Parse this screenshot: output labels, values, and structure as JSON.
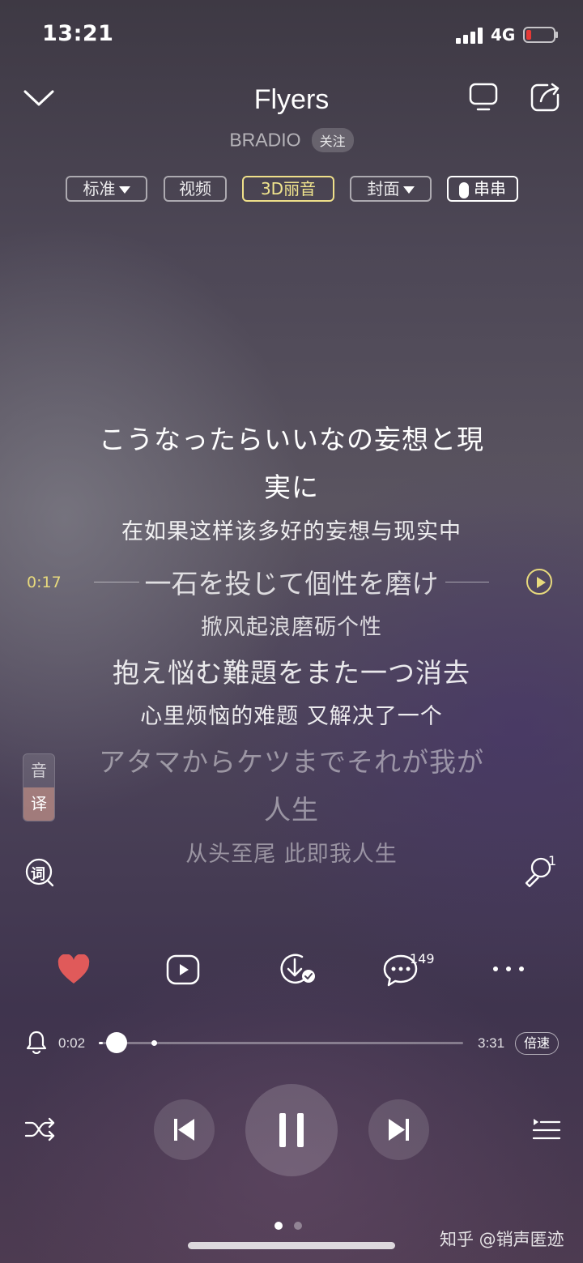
{
  "status_bar": {
    "time": "13:21",
    "network": "4G"
  },
  "header": {
    "title": "Flyers",
    "artist": "BRADIO",
    "follow_label": "关注"
  },
  "chips": {
    "standard": "标准",
    "video": "视频",
    "audio3d": "3D丽音",
    "cover": "封面",
    "chuan": "串串"
  },
  "lyrics": {
    "line1_jp_a": "こうなったらいいなの妄想と現",
    "line1_jp_b": "実に",
    "line1_cn": "在如果这样该多好的妄想与现实中",
    "current_time": "0:17",
    "current_jp": "一石を投じて個性を磨け",
    "current_cn": "掀风起浪磨砺个性",
    "line3_jp": "抱え悩む難題をまた一つ消去",
    "line3_cn": "心里烦恼的难题 又解决了一个",
    "line4_jp_a": "アタマからケツまでそれが我が",
    "line4_jp_b": "人生",
    "line4_cn": "从头至尾 此即我人生"
  },
  "side_toggle": {
    "top": "音",
    "bottom": "译"
  },
  "lyric_button": "词",
  "mic_count": "1",
  "actions": {
    "comment_count": "149"
  },
  "progress": {
    "elapsed": "0:02",
    "total": "3:31",
    "fraction": 0.01,
    "speed_label": "倍速"
  },
  "colors": {
    "accent_gold": "#e8da7d",
    "heart": "#e05a5a"
  },
  "pager": {
    "count": 2,
    "active": 0
  },
  "watermark": "知乎 @销声匿迹"
}
